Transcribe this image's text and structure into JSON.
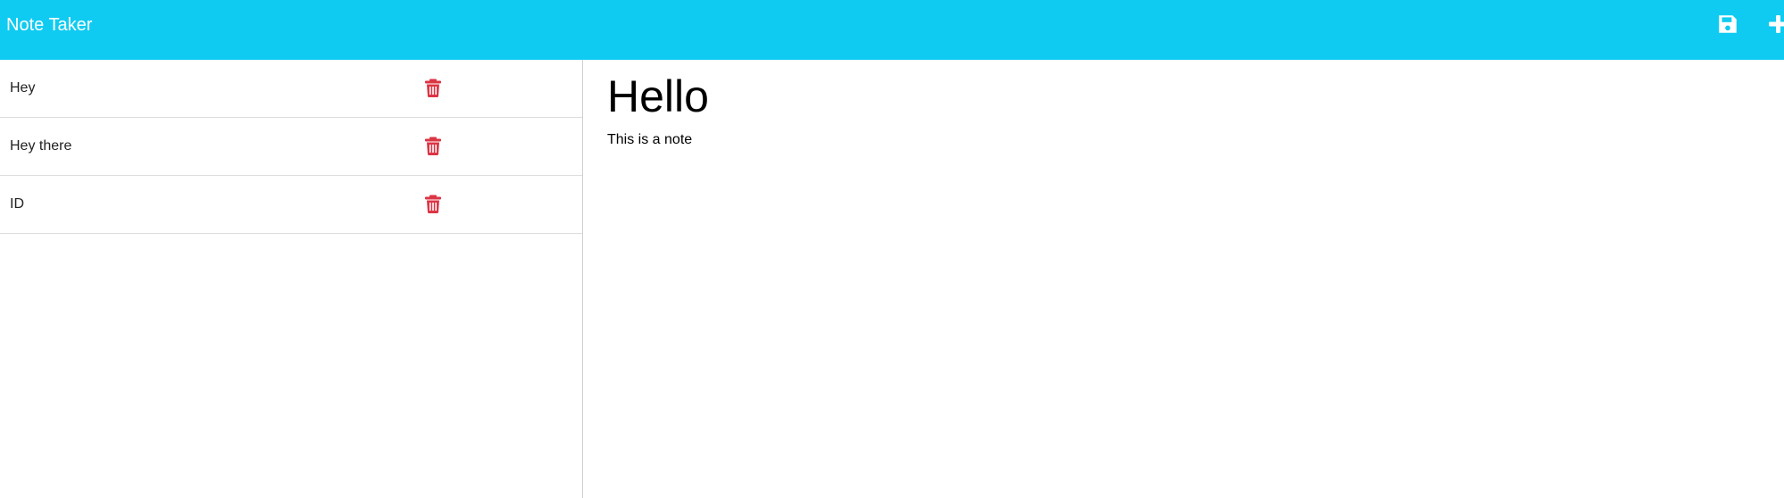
{
  "app": {
    "title": "Note Taker"
  },
  "toolbar": {
    "save_icon": "save-icon",
    "new_icon": "plus-icon"
  },
  "notes": [
    {
      "title": "Hey",
      "delete_icon": "trash-icon"
    },
    {
      "title": "Hey there",
      "delete_icon": "trash-icon"
    },
    {
      "title": "ID",
      "delete_icon": "trash-icon"
    }
  ],
  "active_note": {
    "title": "Hello",
    "text": "This is a note"
  },
  "colors": {
    "navbar": "#10cbf1",
    "danger": "#dc3545",
    "text": "#000000"
  }
}
